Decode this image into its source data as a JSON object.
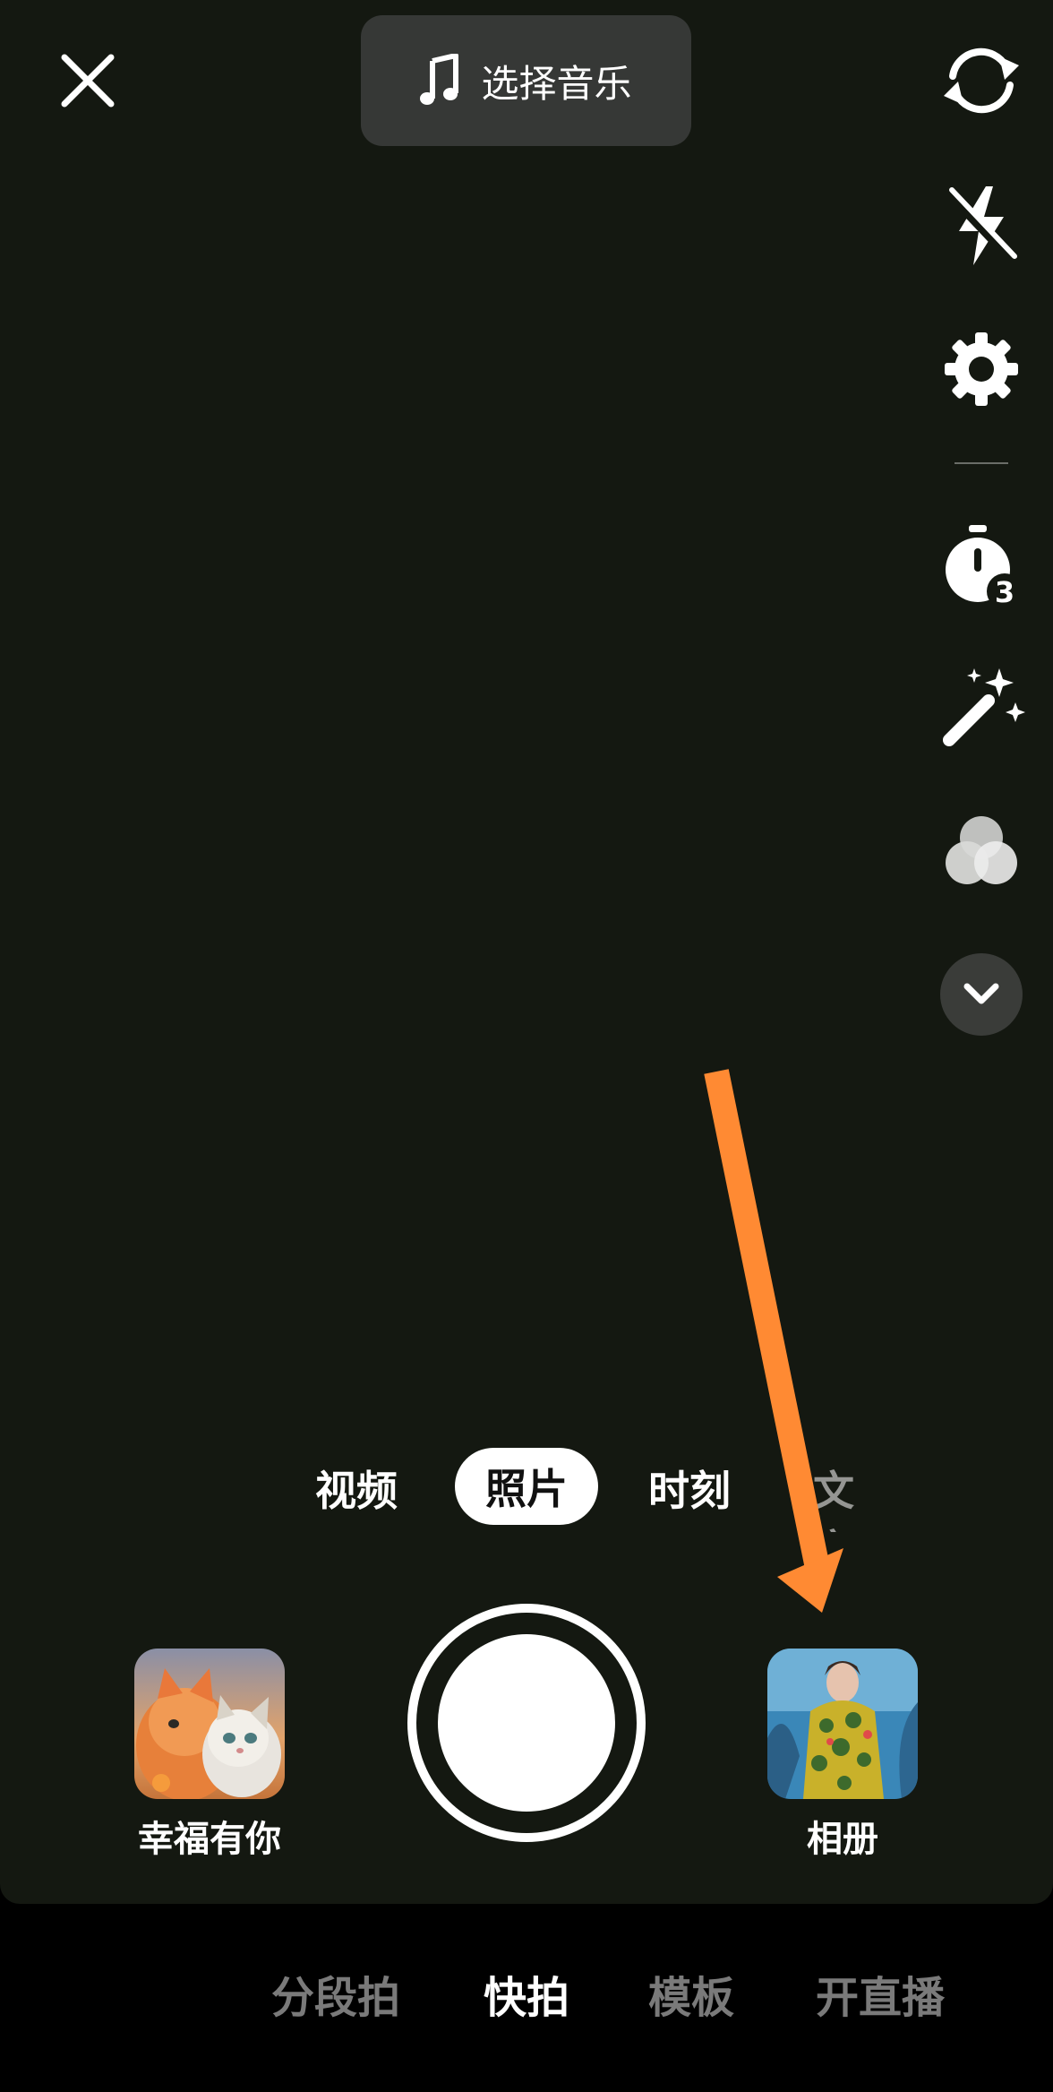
{
  "top": {
    "music_label": "选择音乐"
  },
  "right_toolbar": {
    "icons": [
      "flip-camera-icon",
      "flash-off-icon",
      "settings-icon",
      "timer-icon",
      "beauty-wand-icon",
      "filter-icon",
      "chevron-down-icon"
    ],
    "timer_value": "3"
  },
  "modes": {
    "video": "视频",
    "photo": "照片",
    "moment": "时刻",
    "text": "文字"
  },
  "capture": {
    "left_thumb_label": "幸福有你",
    "right_thumb_label": "相册"
  },
  "bottom_nav": {
    "segment": "分段拍",
    "quick": "快拍",
    "template": "模板",
    "live": "开直播"
  },
  "colors": {
    "viewfinder_bg": "#141811",
    "annotation_arrow": "#FF8A33"
  }
}
